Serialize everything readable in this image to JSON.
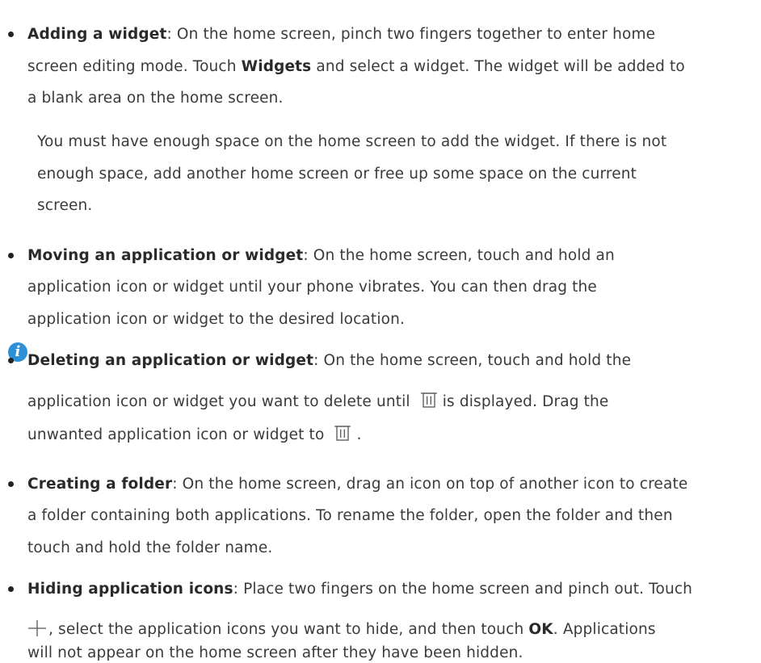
{
  "items": {
    "adding_widget": {
      "title": "Adding a widget",
      "line1": ": On the home screen, pinch two fingers together to enter home",
      "line2_a": "screen editing mode. Touch ",
      "line2_bold": "Widgets",
      "line2_b": " and select a widget. The widget will be added to",
      "line3": "a blank area on the home screen."
    },
    "note": {
      "icon": "info-icon",
      "line1": "You must have enough space on the home screen to add the widget. If there is not",
      "line2": "enough space, add another home screen or free up some space on the current",
      "line3": "screen."
    },
    "moving": {
      "title": "Moving an application or widget",
      "line1": ": On the home screen, touch and hold an",
      "line2": "application icon or widget until your phone vibrates. You can then drag the",
      "line3": "application icon or widget to the desired location."
    },
    "deleting": {
      "title": "Deleting an application or widget",
      "line1": ": On the home screen, touch and hold the",
      "line2_a": "application icon or widget you want to delete until",
      "line2_b": "is displayed. Drag the",
      "line3_a": "unwanted application icon or widget to",
      "line3_b": "."
    },
    "folder": {
      "title": "Creating a folder",
      "line1": ": On the home screen, drag an icon on top of another icon to create",
      "line2": "a folder containing both applications. To rename the folder, open the folder and then",
      "line3": "touch and hold the folder name."
    },
    "hiding": {
      "title": "Hiding application icons",
      "line1": ": Place two fingers on the home screen and pinch out. Touch",
      "line2_a": ", select the application icons you want to hide, and then touch ",
      "line2_bold": "OK",
      "line2_b": ". Applications",
      "line3": "will not appear on the home screen after they have been hidden."
    }
  }
}
